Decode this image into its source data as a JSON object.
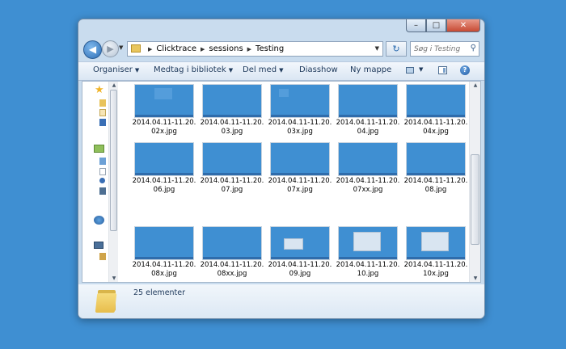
{
  "window": {
    "controls": {
      "minimize": "–",
      "maximize": "□",
      "close": "✕"
    }
  },
  "navigation": {
    "back_glyph": "◀",
    "forward_glyph": "▶",
    "recent_glyph": "▼",
    "breadcrumb": [
      "Clicktrace",
      "sessions",
      "Testing"
    ],
    "separator": "▶",
    "dropdown_glyph": "▼",
    "refresh_glyph": "↻",
    "search_placeholder": "Søg i Testing"
  },
  "toolbar": {
    "organise": "Organiser",
    "include": "Medtag i bibliotek",
    "share": "Del med",
    "slideshow": "Diasshow",
    "new_folder": "Ny mappe",
    "dropdown_glyph": "▼",
    "help": "?"
  },
  "files": [
    {
      "line1": "2014.04.11-11.20.",
      "line2": "02x.jpg",
      "preview": "pane"
    },
    {
      "line1": "2014.04.11-11.20.",
      "line2": "03.jpg",
      "preview": "blank"
    },
    {
      "line1": "2014.04.11-11.20.",
      "line2": "03x.jpg",
      "preview": "small-pane"
    },
    {
      "line1": "2014.04.11-11.20.",
      "line2": "04.jpg",
      "preview": "blank"
    },
    {
      "line1": "2014.04.11-11.20.",
      "line2": "04x.jpg",
      "preview": "blank"
    },
    {
      "line1": "2014.04.11-11.20.",
      "line2": "06.jpg",
      "preview": "blank"
    },
    {
      "line1": "2014.04.11-11.20.",
      "line2": "07.jpg",
      "preview": "blank"
    },
    {
      "line1": "2014.04.11-11.20.",
      "line2": "07x.jpg",
      "preview": "blank"
    },
    {
      "line1": "2014.04.11-11.20.",
      "line2": "07xx.jpg",
      "preview": "blank"
    },
    {
      "line1": "2014.04.11-11.20.",
      "line2": "08.jpg",
      "preview": "blank"
    },
    {
      "line1": "2014.04.11-11.20.",
      "line2": "08x.jpg",
      "preview": "blank"
    },
    {
      "line1": "2014.04.11-11.20.",
      "line2": "08xx.jpg",
      "preview": "blank"
    },
    {
      "line1": "2014.04.11-11.20.",
      "line2": "09.jpg",
      "preview": "dialog"
    },
    {
      "line1": "2014.04.11-11.20.",
      "line2": "10.jpg",
      "preview": "window"
    },
    {
      "line1": "2014.04.11-11.20.",
      "line2": "10x.jpg",
      "preview": "window"
    }
  ],
  "status": {
    "item_count": "25 elementer"
  },
  "colors": {
    "desktop": "#3f8fd2",
    "thumbnail": "#3f8fd2",
    "accent": "#2e6fb7"
  },
  "icons": [
    "star-icon",
    "folder-icon",
    "network-icon",
    "computer-icon",
    "search-icon",
    "help-icon",
    "view-icon",
    "preview-pane-icon"
  ]
}
